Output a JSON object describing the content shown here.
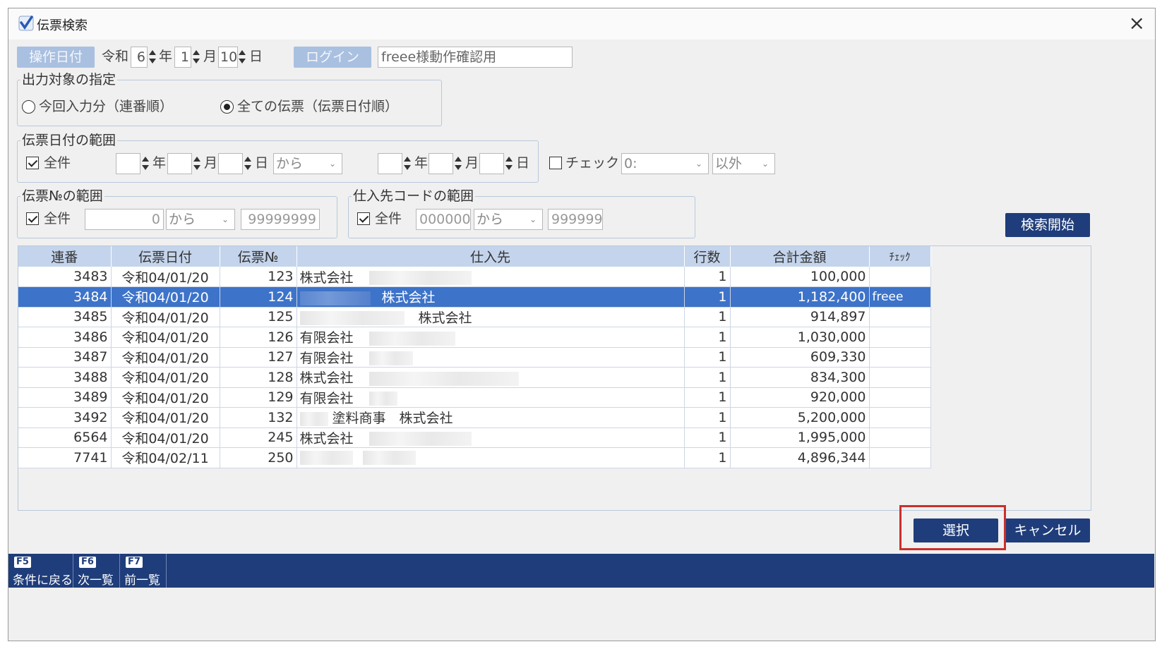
{
  "window": {
    "title": "伝票検索",
    "close": "×"
  },
  "header": {
    "op_date_label": "操作日付",
    "era": "令和",
    "year": "6",
    "year_unit": "年",
    "month": "1",
    "month_unit": "月",
    "day": "10",
    "day_unit": "日",
    "login_label": "ログイン",
    "login_value": "freee様動作確認用"
  },
  "output_target": {
    "legend": "出力対象の指定",
    "option1": "今回入力分（連番順）",
    "option2": "全ての伝票（伝票日付順）",
    "selected": "option2"
  },
  "date_range": {
    "legend": "伝票日付の範囲",
    "all_label": "全件",
    "all_checked": true,
    "year_unit": "年",
    "month_unit": "月",
    "day_unit": "日",
    "from_label": "から",
    "check_label": "チェック",
    "check_checked": false,
    "check_value": "0:",
    "except_value": "以外"
  },
  "no_range": {
    "legend": "伝票№の範囲",
    "all_label": "全件",
    "all_checked": true,
    "from_value": "0",
    "from_label": "から",
    "to_value": "99999999"
  },
  "supplier_range": {
    "legend": "仕入先コードの範囲",
    "all_label": "全件",
    "all_checked": true,
    "from_value": "000000",
    "from_label": "から",
    "to_value": "999999"
  },
  "search_button": "検索開始",
  "table": {
    "headers": [
      "連番",
      "伝票日付",
      "伝票№",
      "仕入先",
      "行数",
      "合計金額",
      "ﾁｪｯｸ"
    ],
    "rows": [
      {
        "seq": "3483",
        "date": "令和04/01/20",
        "no": "123",
        "supplier": "株式会社",
        "lines": "1",
        "total": "100,000",
        "check": ""
      },
      {
        "seq": "3484",
        "date": "令和04/01/20",
        "no": "124",
        "supplier": "株式会社",
        "lines": "1",
        "total": "1,182,400",
        "check": "freee"
      },
      {
        "seq": "3485",
        "date": "令和04/01/20",
        "no": "125",
        "supplier": "株式会社",
        "lines": "1",
        "total": "914,897",
        "check": ""
      },
      {
        "seq": "3486",
        "date": "令和04/01/20",
        "no": "126",
        "supplier": "有限会社",
        "lines": "1",
        "total": "1,030,000",
        "check": ""
      },
      {
        "seq": "3487",
        "date": "令和04/01/20",
        "no": "127",
        "supplier": "有限会社",
        "lines": "1",
        "total": "609,330",
        "check": ""
      },
      {
        "seq": "3488",
        "date": "令和04/01/20",
        "no": "128",
        "supplier": "株式会社",
        "lines": "1",
        "total": "834,300",
        "check": ""
      },
      {
        "seq": "3489",
        "date": "令和04/01/20",
        "no": "129",
        "supplier": "有限会社",
        "lines": "1",
        "total": "920,000",
        "check": ""
      },
      {
        "seq": "3492",
        "date": "令和04/01/20",
        "no": "132",
        "supplier": "塗料商事　株式会社",
        "lines": "1",
        "total": "5,200,000",
        "check": ""
      },
      {
        "seq": "6564",
        "date": "令和04/01/20",
        "no": "245",
        "supplier": "株式会社",
        "lines": "1",
        "total": "1,995,000",
        "check": ""
      },
      {
        "seq": "7741",
        "date": "令和04/02/11",
        "no": "250",
        "supplier": "",
        "lines": "1",
        "total": "4,896,344",
        "check": ""
      }
    ]
  },
  "buttons": {
    "select": "選択",
    "cancel": "キャンセル"
  },
  "function_keys": [
    {
      "key": "F5",
      "label": "条件に戻る"
    },
    {
      "key": "F6",
      "label": "次一覧"
    },
    {
      "key": "F7",
      "label": "前一覧"
    }
  ]
}
